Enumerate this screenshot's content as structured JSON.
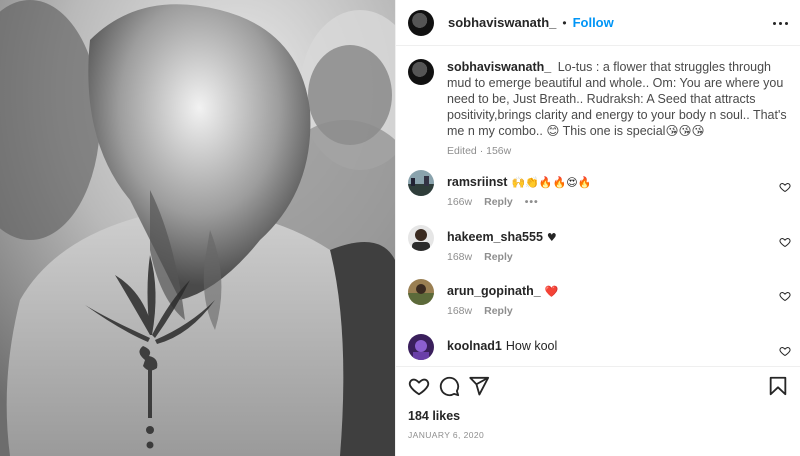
{
  "post": {
    "username": "sobhaviswanath_",
    "separator": "•",
    "follow_label": "Follow",
    "more_icon": "more-horizontal-icon"
  },
  "caption": {
    "username": "sobhaviswanath_",
    "text": "Lo-tus : a flower that struggles through mud to emerge beautiful and whole.. Om: You are where you need to be, Just Breath.. Rudraksh: A Seed that attracts positivity,brings clarity and energy to your body n soul.. That's me n my combo.. 😊 This one is special😘😘😘",
    "edited": "Edited",
    "age": "156w"
  },
  "comments": [
    {
      "username": "ramsriinst",
      "text": "🙌👏🔥🔥😍🔥",
      "age": "166w",
      "reply_label": "Reply",
      "more": "•••"
    },
    {
      "username": "hakeem_sha555",
      "text": "♥",
      "age": "168w",
      "reply_label": "Reply"
    },
    {
      "username": "arun_gopinath_",
      "text": "❤️",
      "age": "168w",
      "reply_label": "Reply"
    },
    {
      "username": "koolnad1",
      "text": "How kool",
      "age": "",
      "reply_label": ""
    }
  ],
  "actions": {
    "like_icon": "heart-icon",
    "comment_icon": "comment-icon",
    "share_icon": "send-icon",
    "save_icon": "bookmark-icon"
  },
  "likes": "184 likes",
  "date": "JANUARY 6, 2020",
  "colors": {
    "accent": "#0095f6",
    "heart_red": "#ed4956",
    "text": "#262626",
    "muted": "#8e8e8e"
  }
}
